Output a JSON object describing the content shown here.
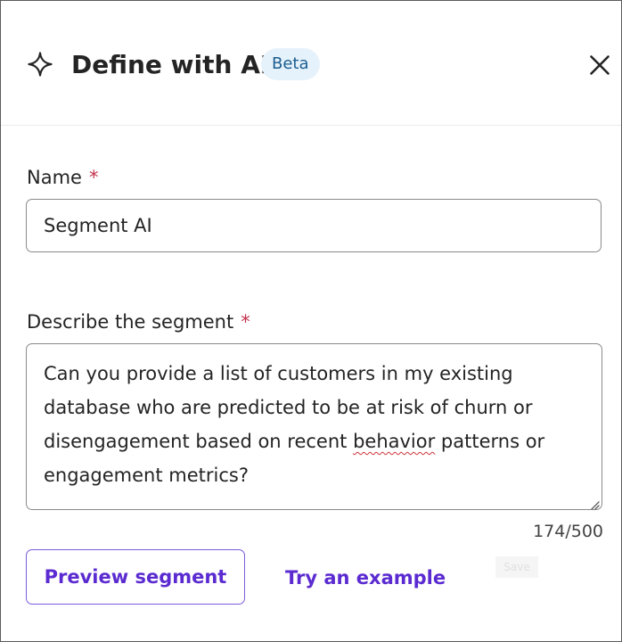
{
  "header": {
    "title": "Define with AI",
    "badge": "Beta",
    "icon": "sparkle-icon",
    "close_icon": "close-icon"
  },
  "form": {
    "name": {
      "label": "Name",
      "required_marker": "*",
      "value": "Segment AI"
    },
    "description": {
      "label": "Describe the segment",
      "required_marker": "*",
      "value_before_misspelling": "Can you provide a list of customers in my existing database who are predicted to be at risk of churn or disengagement based on recent ",
      "misspelled_word": "behavior",
      "value_after_misspelling": " patterns or engagement metrics?",
      "char_count": "174/500"
    }
  },
  "actions": {
    "preview_label": "Preview segment",
    "example_label": "Try an example",
    "save_label": "Save"
  },
  "colors": {
    "accent": "#5b2bd1",
    "required": "#c4314b",
    "badge_background": "#e6f2fb",
    "badge_text": "#1a5d91",
    "border": "#8a8a8a"
  }
}
